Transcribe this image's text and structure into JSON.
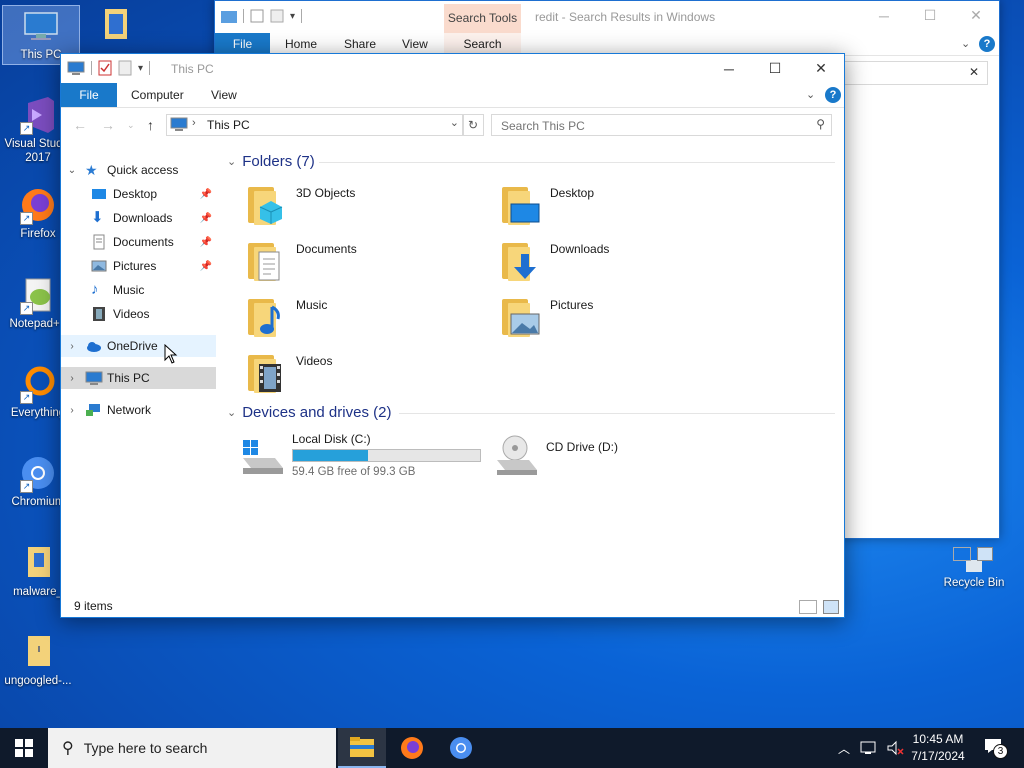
{
  "desktop": {
    "icons": [
      {
        "label": "This PC",
        "icon": "computer-icon"
      },
      {
        "label": "",
        "icon": "file-icon"
      },
      {
        "label": "Visual Studio 2017",
        "icon": "visual-studio-icon"
      },
      {
        "label": "Firefox",
        "icon": "firefox-icon"
      },
      {
        "label": "Notepad++",
        "icon": "notepad-plus-plus-icon"
      },
      {
        "label": "Everything",
        "icon": "everything-icon"
      },
      {
        "label": "Chromium",
        "icon": "chromium-icon"
      },
      {
        "label": "malware_",
        "icon": "archive-icon"
      },
      {
        "label": "ungoogled-...",
        "icon": "archive-icon"
      },
      {
        "label": "Recycle Bin",
        "icon": "recycle-bin-icon"
      }
    ]
  },
  "background_window": {
    "title": "redit - Search Results in Windows",
    "context_tab": "Search Tools",
    "tabs": [
      "File",
      "Home",
      "Share",
      "View",
      "Search"
    ]
  },
  "window": {
    "title": "This PC",
    "tabs": {
      "file": "File",
      "computer": "Computer",
      "view": "View"
    },
    "address": "This PC",
    "search_placeholder": "Search This PC",
    "nav": {
      "quick_access": "Quick access",
      "quick_items": [
        "Desktop",
        "Downloads",
        "Documents",
        "Pictures",
        "Music",
        "Videos"
      ],
      "onedrive": "OneDrive",
      "this_pc": "This PC",
      "network": "Network"
    },
    "folders_header": "Folders (7)",
    "folders": [
      "3D Objects",
      "Desktop",
      "Documents",
      "Downloads",
      "Music",
      "Pictures",
      "Videos"
    ],
    "drives_header": "Devices and drives (2)",
    "drives": [
      {
        "name": "Local Disk (C:)",
        "free": "59.4 GB free of 99.3 GB",
        "used_fraction": 0.402
      },
      {
        "name": "CD Drive (D:)"
      }
    ],
    "status": "9 items"
  },
  "taskbar": {
    "search_placeholder": "Type here to search",
    "time": "10:45 AM",
    "date": "7/17/2024",
    "notification_count": "3"
  },
  "colors": {
    "accent": "#1979ca",
    "drive_bar": "#26a0da",
    "folder": "#f7d67a"
  }
}
